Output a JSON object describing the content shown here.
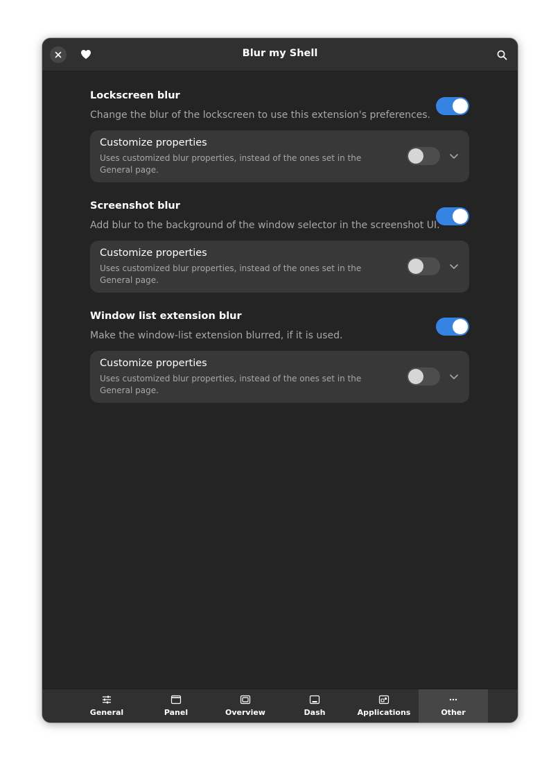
{
  "window": {
    "title": "Blur my Shell",
    "close_icon": "close-icon",
    "heart_icon": "heart-icon",
    "search_icon": "search-icon"
  },
  "colors": {
    "accent": "#3584e4",
    "window_bg": "#242424",
    "header_bg": "#303030",
    "card_bg": "#383838"
  },
  "sections": [
    {
      "title": "Lockscreen blur",
      "description": "Change the blur of the lockscreen to use this extension's preferences.",
      "enabled": true,
      "customize": {
        "title": "Customize properties",
        "description": "Uses customized blur properties, instead of the ones set in the General page.",
        "enabled": false
      }
    },
    {
      "title": "Screenshot blur",
      "description": "Add blur to the background of the window selector in the screenshot UI.",
      "enabled": true,
      "customize": {
        "title": "Customize properties",
        "description": "Uses customized blur properties, instead of the ones set in the General page.",
        "enabled": false
      }
    },
    {
      "title": "Window list extension blur",
      "description": "Make the window-list extension blurred, if it is used.",
      "enabled": true,
      "customize": {
        "title": "Customize properties",
        "description": "Uses customized blur properties, instead of the ones set in the General page.",
        "enabled": false
      }
    }
  ],
  "tabs": [
    {
      "label": "General",
      "icon": "sliders-icon",
      "active": false
    },
    {
      "label": "Panel",
      "icon": "panel-icon",
      "active": false
    },
    {
      "label": "Overview",
      "icon": "overview-icon",
      "active": false
    },
    {
      "label": "Dash",
      "icon": "dash-icon",
      "active": false
    },
    {
      "label": "Applications",
      "icon": "applications-icon",
      "active": false
    },
    {
      "label": "Other",
      "icon": "more-icon",
      "active": true
    }
  ]
}
